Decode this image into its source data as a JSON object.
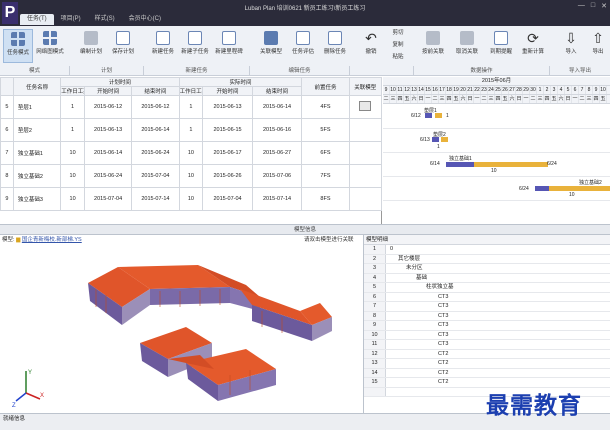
{
  "app": {
    "logo_glyph": "P",
    "title": "Luban Plan 培训0621 新员工练习\\新员工练习"
  },
  "window_controls": [
    "—",
    "□",
    "✕"
  ],
  "menu": [
    {
      "label": "任务(T)",
      "active": true
    },
    {
      "label": "项目(P)",
      "active": false
    },
    {
      "label": "样式(S)",
      "active": false
    },
    {
      "label": "会员中心(C)",
      "active": false
    }
  ],
  "ribbon": {
    "buttons": [
      {
        "label": "任务模式",
        "icon": "task-mode-icon"
      },
      {
        "label": "网络图模式",
        "icon": "network-diagram-icon"
      },
      {
        "label": "编制计划",
        "icon": "edit-plan-icon"
      },
      {
        "label": "保存计划",
        "icon": "save-plan-icon"
      },
      {
        "label": "新建任务",
        "icon": "new-task-icon"
      },
      {
        "label": "新建子任务",
        "icon": "new-subtask-icon"
      },
      {
        "label": "新建里程碑",
        "icon": "new-milestone-icon"
      },
      {
        "label": "关联模型",
        "icon": "link-model-icon"
      },
      {
        "label": "任务评估",
        "icon": "task-evaluate-icon"
      },
      {
        "label": "删除任务",
        "icon": "delete-task-icon"
      },
      {
        "label": "撤销",
        "icon": "undo-icon"
      },
      {
        "label": "剪切",
        "icon": "cut-icon"
      },
      {
        "label": "复制",
        "icon": "copy-icon"
      },
      {
        "label": "粘贴",
        "icon": "paste-icon"
      },
      {
        "label": "按前关联",
        "icon": "link-before-icon"
      },
      {
        "label": "取消关联",
        "icon": "unlink-icon"
      },
      {
        "label": "到期提醒",
        "icon": "due-reminder-icon"
      },
      {
        "label": "重新计算",
        "icon": "recalc-icon"
      },
      {
        "label": "导入",
        "icon": "import-icon"
      },
      {
        "label": "导出",
        "icon": "export-icon"
      }
    ],
    "groups": [
      "模式",
      "计划",
      "新建任务",
      "编辑任务",
      "",
      "数据操作",
      "",
      "导入导出"
    ]
  },
  "table": {
    "group_headers": {
      "plan": "计划时间",
      "actual": "实际时间"
    },
    "columns": [
      "",
      "任务名称",
      "工作日工期",
      "开始时间",
      "结束时间",
      "工作日工期",
      "开始时间",
      "结束时间",
      "前置任务",
      "关联模型"
    ],
    "rows": [
      {
        "id": "5",
        "name": "垫层1",
        "plan_days": "1",
        "plan_start": "2015-06-12",
        "plan_end": "2015-06-12",
        "act_days": "1",
        "act_start": "2015-06-13",
        "act_end": "2015-06-14",
        "pred": "4FS",
        "model": true
      },
      {
        "id": "6",
        "name": "垫层2",
        "plan_days": "1",
        "plan_start": "2015-06-13",
        "plan_end": "2015-06-14",
        "act_days": "1",
        "act_start": "2015-06-15",
        "act_end": "2015-06-16",
        "pred": "5FS",
        "model": false
      },
      {
        "id": "7",
        "name": "独立基础1",
        "plan_days": "10",
        "plan_start": "2015-06-14",
        "plan_end": "2015-06-24",
        "act_days": "10",
        "act_start": "2015-06-17",
        "act_end": "2015-06-27",
        "pred": "6FS",
        "model": false
      },
      {
        "id": "8",
        "name": "独立基础2",
        "plan_days": "10",
        "plan_start": "2015-06-24",
        "plan_end": "2015-07-04",
        "act_days": "10",
        "act_start": "2015-06-26",
        "act_end": "2015-07-06",
        "pred": "7FS",
        "model": false
      },
      {
        "id": "9",
        "name": "独立基础3",
        "plan_days": "10",
        "plan_start": "2015-07-04",
        "plan_end": "2015-07-14",
        "act_days": "10",
        "act_start": "2015-07-04",
        "act_end": "2015-07-14",
        "pred": "8FS",
        "model": false
      }
    ]
  },
  "gantt": {
    "month": "2015年06月",
    "days": [
      "9",
      "10",
      "11",
      "12",
      "13",
      "14",
      "15",
      "16",
      "17",
      "18",
      "19",
      "20",
      "21",
      "22",
      "23",
      "24",
      "25",
      "26",
      "27",
      "28",
      "29",
      "30",
      "1",
      "2",
      "3",
      "4",
      "5",
      "6",
      "7",
      "8",
      "9",
      "10"
    ],
    "weekdays": [
      "二",
      "三",
      "四",
      "五",
      "六",
      "日",
      "一",
      "二",
      "三",
      "四",
      "五",
      "六",
      "日",
      "一",
      "二",
      "三",
      "四",
      "五",
      "六",
      "日",
      "一",
      "二",
      "三",
      "四",
      "五",
      "六",
      "日",
      "一",
      "二",
      "三",
      "四",
      "五"
    ],
    "labels": [
      {
        "text": "垫层1"
      },
      {
        "text": "6/12"
      },
      {
        "text": "1"
      },
      {
        "text": "垫层2"
      },
      {
        "text": "6/13"
      },
      {
        "text": "1"
      },
      {
        "text": "独立基础1"
      },
      {
        "text": "6/14"
      },
      {
        "text": "6/24"
      },
      {
        "text": "10"
      },
      {
        "text": "独立基础2"
      },
      {
        "text": "6/24"
      },
      {
        "text": "10"
      }
    ]
  },
  "splitter_label": "模型信息",
  "viewer": {
    "prefix": "模型:",
    "model_link": "国企青新梅校.新部梯.YS",
    "hint": "请双击模型进行关联"
  },
  "tree": {
    "header": "模型明细",
    "rows": [
      {
        "n": "1",
        "t": "0"
      },
      {
        "n": "2",
        "t": "其它楼层"
      },
      {
        "n": "3",
        "t": "未分区"
      },
      {
        "n": "4",
        "t": "基础"
      },
      {
        "n": "5",
        "t": "柱状独立基"
      },
      {
        "n": "6",
        "t": "CT3"
      },
      {
        "n": "7",
        "t": "CT3"
      },
      {
        "n": "8",
        "t": "CT3"
      },
      {
        "n": "9",
        "t": "CT3"
      },
      {
        "n": "10",
        "t": "CT3"
      },
      {
        "n": "11",
        "t": "CT3"
      },
      {
        "n": "12",
        "t": "CT2"
      },
      {
        "n": "13",
        "t": "CT2"
      },
      {
        "n": "14",
        "t": "CT2"
      },
      {
        "n": "15",
        "t": "CT2"
      }
    ]
  },
  "statusbar": "就绪信息",
  "watermark": "最需教育",
  "colors": {
    "accent": "#5656b4",
    "actual_bar": "#e9b23b",
    "title_bg": "#2b2b3a",
    "roof": "#e0552a"
  }
}
